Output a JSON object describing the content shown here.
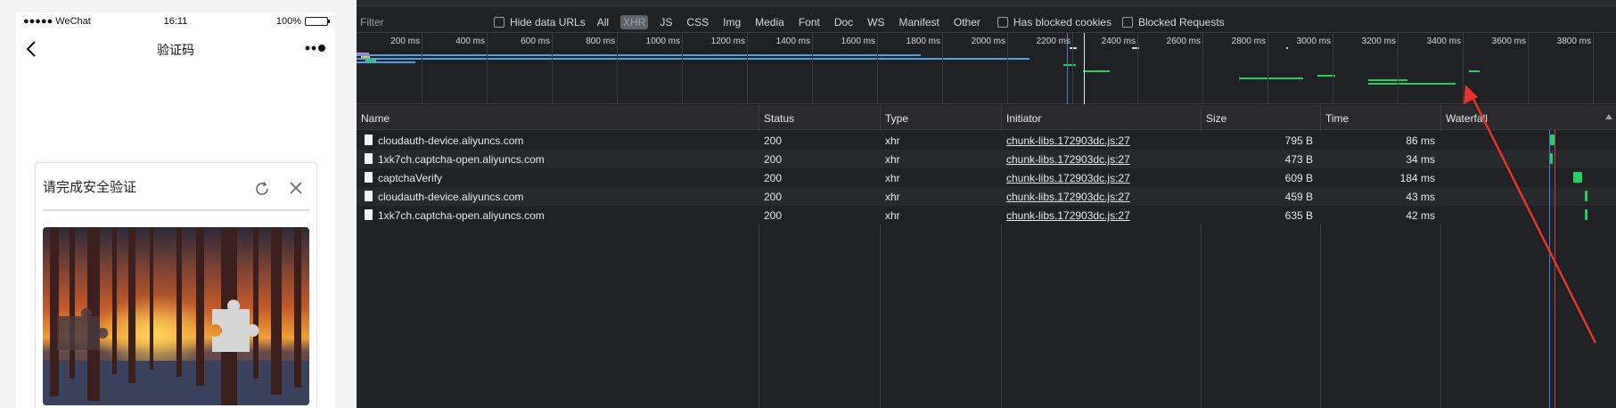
{
  "phone": {
    "status_left": "●●●●● WeChat",
    "status_time": "16:11",
    "status_battery": "100%",
    "battery_level": 1.0,
    "nav_title": "验证码",
    "nav_back_icon": "chevron-left-icon",
    "nav_more_icon": "more-dots-icon",
    "captcha": {
      "title": "请完成安全验证",
      "refresh_icon": "refresh-icon",
      "close_icon": "close-icon",
      "image_desc_icon": "forest-sunset-puzzle-image"
    }
  },
  "devtools": {
    "filter_placeholder": "Filter",
    "checkboxes": {
      "hide_data_urls": "Hide data URLs",
      "has_blocked_cookies": "Has blocked cookies",
      "blocked_requests": "Blocked Requests"
    },
    "type_filters": [
      "All",
      "XHR",
      "JS",
      "CSS",
      "Img",
      "Media",
      "Font",
      "Doc",
      "WS",
      "Manifest",
      "Other"
    ],
    "active_type_filter": "XHR",
    "overview_ticks": [
      "200 ms",
      "400 ms",
      "600 ms",
      "800 ms",
      "1000 ms",
      "1200 ms",
      "1400 ms",
      "1600 ms",
      "1800 ms",
      "2000 ms",
      "2200 ms",
      "2400 ms",
      "2600 ms",
      "2800 ms",
      "3000 ms",
      "3200 ms",
      "3400 ms",
      "3600 ms",
      "3800 ms"
    ],
    "columns": {
      "name": "Name",
      "status": "Status",
      "type": "Type",
      "initiator": "Initiator",
      "size": "Size",
      "time": "Time",
      "waterfall": "Waterfall"
    },
    "requests": [
      {
        "name": "cloudauth-device.aliyuncs.com",
        "status": "200",
        "type": "xhr",
        "initiator": "chunk-libs.172903dc.js:27",
        "size": "795 B",
        "time": "86 ms"
      },
      {
        "name": "1xk7ch.captcha-open.aliyuncs.com",
        "status": "200",
        "type": "xhr",
        "initiator": "chunk-libs.172903dc.js:27",
        "size": "473 B",
        "time": "34 ms"
      },
      {
        "name": "captchaVerify",
        "status": "200",
        "type": "xhr",
        "initiator": "chunk-libs.172903dc.js:27",
        "size": "609 B",
        "time": "184 ms"
      },
      {
        "name": "cloudauth-device.aliyuncs.com",
        "status": "200",
        "type": "xhr",
        "initiator": "chunk-libs.172903dc.js:27",
        "size": "459 B",
        "time": "43 ms"
      },
      {
        "name": "1xk7ch.captcha-open.aliyuncs.com",
        "status": "200",
        "type": "xhr",
        "initiator": "chunk-libs.172903dc.js:27",
        "size": "635 B",
        "time": "42 ms"
      }
    ],
    "colors": {
      "waterfall_green": "#1fd360",
      "timeline_blue": "#4c7bd9",
      "annotation_red": "#e8322a"
    }
  }
}
